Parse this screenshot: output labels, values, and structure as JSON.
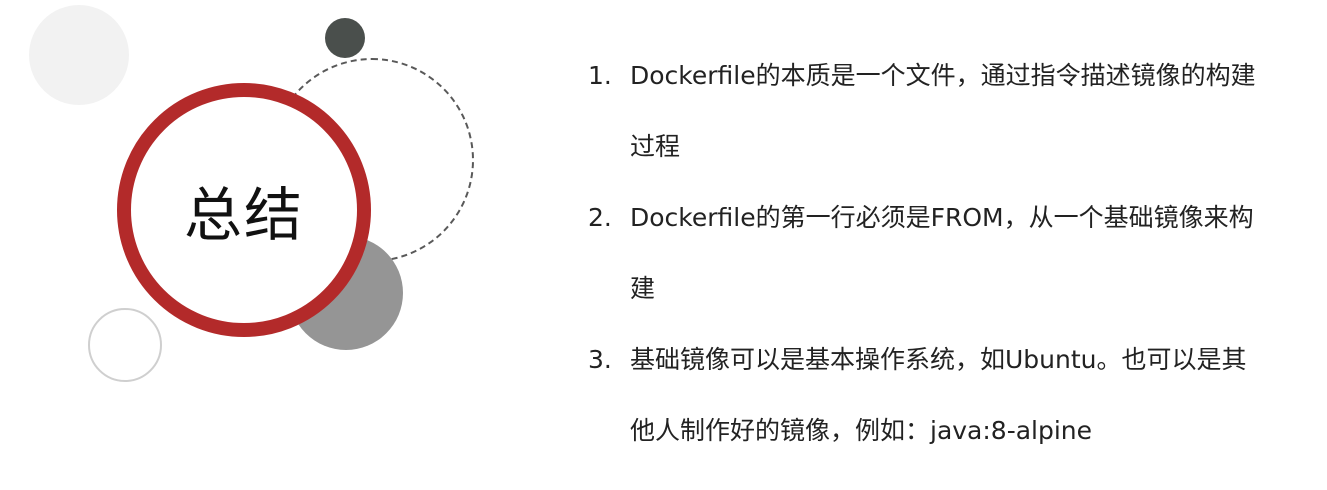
{
  "slide": {
    "title": "总结",
    "points": [
      {
        "number": "1.",
        "text": "Dockerfile的本质是一个文件，通过指令描述镜像的构建过程"
      },
      {
        "number": "2.",
        "text": "Dockerfile的第一行必须是FROM，从一个基础镜像来构建"
      },
      {
        "number": "3.",
        "text": "基础镜像可以是基本操作系统，如Ubuntu。也可以是其他人制作好的镜像，例如：java:8-alpine"
      }
    ]
  },
  "colors": {
    "ring": "#b32a2a",
    "dark_circle": "#4a4f4c",
    "gray_circle": "#959595",
    "light_circle": "#f2f2f2"
  }
}
